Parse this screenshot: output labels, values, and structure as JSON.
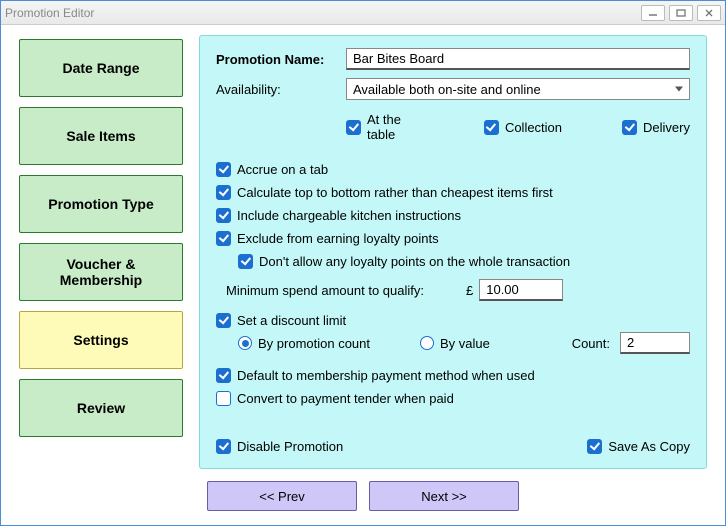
{
  "window": {
    "title": "Promotion Editor"
  },
  "sidebar": {
    "items": [
      {
        "label": "Date Range"
      },
      {
        "label": "Sale Items"
      },
      {
        "label": "Promotion Type"
      },
      {
        "label": "Voucher & Membership"
      },
      {
        "label": "Settings"
      },
      {
        "label": "Review"
      }
    ],
    "active_index": 4
  },
  "form": {
    "name_label": "Promotion Name:",
    "name_value": "Bar Bites Board",
    "availability_label": "Availability:",
    "availability_value": "Available both on-site and online",
    "channel_at_table": "At the table",
    "channel_collection": "Collection",
    "channel_delivery": "Delivery",
    "accrue_tab": "Accrue on a tab",
    "top_to_bottom": "Calculate top to bottom rather than cheapest items first",
    "include_kitchen": "Include chargeable kitchen instructions",
    "exclude_loyalty": "Exclude from earning loyalty points",
    "no_loyalty_whole": "Don't allow any loyalty points on the whole transaction",
    "min_spend_label": "Minimum spend amount to qualify:",
    "currency": "£",
    "min_spend_value": "10.00",
    "set_discount_limit": "Set a discount limit",
    "by_promo_count": "By promotion count",
    "by_value": "By value",
    "count_label": "Count:",
    "count_value": "2",
    "default_membership": "Default to membership payment method when used",
    "convert_tender": "Convert to payment tender when paid",
    "disable_promo": "Disable Promotion",
    "save_as_copy": "Save As Copy"
  },
  "buttons": {
    "prev": "<< Prev",
    "next": "Next >>"
  }
}
